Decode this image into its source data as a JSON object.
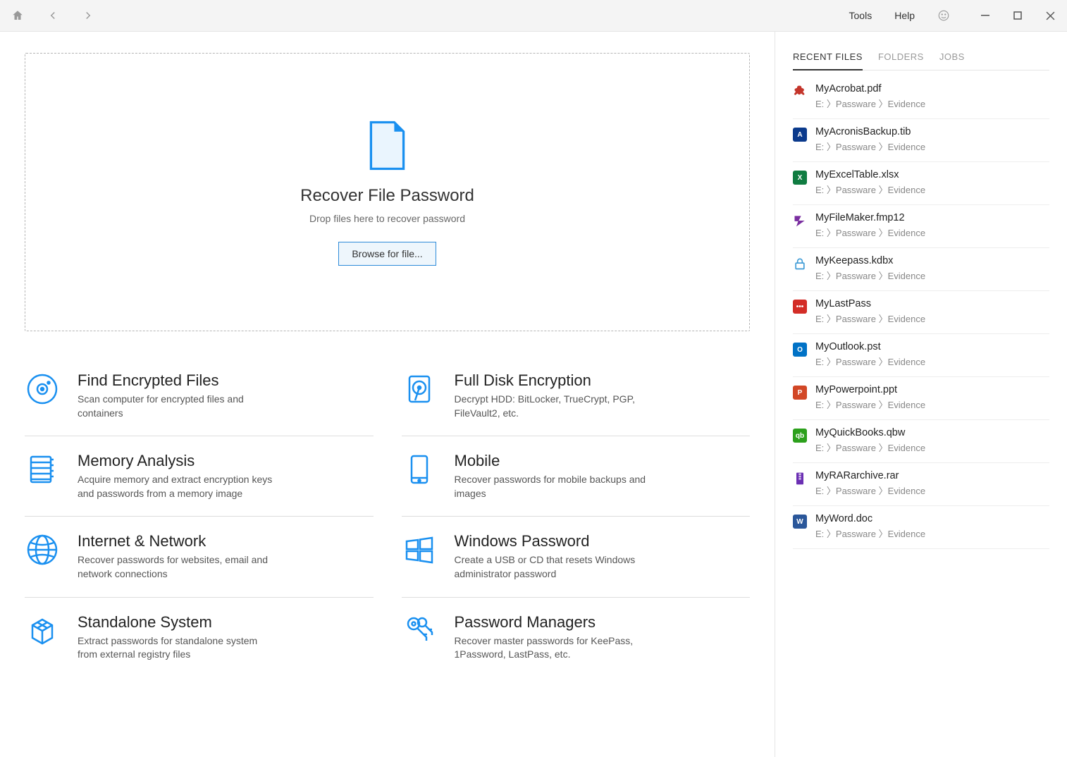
{
  "toolbar": {
    "menu": {
      "tools": "Tools",
      "help": "Help"
    }
  },
  "dropzone": {
    "title": "Recover File Password",
    "subtitle": "Drop files here to recover password",
    "browse_label": "Browse for file..."
  },
  "features": [
    {
      "title": "Find Encrypted Files",
      "desc": "Scan computer for encrypted files and containers",
      "icon": "disc"
    },
    {
      "title": "Memory Analysis",
      "desc": "Acquire memory and extract encryption keys and passwords from a memory image",
      "icon": "memory"
    },
    {
      "title": "Internet & Network",
      "desc": "Recover passwords for websites, email and network connections",
      "icon": "globe"
    },
    {
      "title": "Standalone System",
      "desc": "Extract passwords for standalone system from external registry files",
      "icon": "cube"
    },
    {
      "title": "Full Disk Encryption",
      "desc": "Decrypt HDD: BitLocker, TrueCrypt, PGP, FileVault2, etc.",
      "icon": "hdd"
    },
    {
      "title": "Mobile",
      "desc": "Recover passwords for mobile backups and images",
      "icon": "mobile"
    },
    {
      "title": "Windows Password",
      "desc": "Create a USB or CD that resets Windows administrator password",
      "icon": "windows"
    },
    {
      "title": "Password Managers",
      "desc": "Recover master passwords for KeePass, 1Password, LastPass, etc.",
      "icon": "key"
    }
  ],
  "sidebar": {
    "tabs": [
      {
        "label": "RECENT FILES",
        "active": true
      },
      {
        "label": "FOLDERS",
        "active": false
      },
      {
        "label": "JOBS",
        "active": false
      }
    ],
    "recent": [
      {
        "name": "MyAcrobat.pdf",
        "path": "E: 〉Passware 〉Evidence",
        "iconColor": "#c4352b",
        "iconText": "",
        "iconKind": "pdf"
      },
      {
        "name": "MyAcronisBackup.tib",
        "path": "E: 〉Passware 〉Evidence",
        "iconColor": "#0b3a8c",
        "iconText": "A"
      },
      {
        "name": "MyExcelTable.xlsx",
        "path": "E: 〉Passware 〉Evidence",
        "iconColor": "#107c41",
        "iconText": "X"
      },
      {
        "name": "MyFileMaker.fmp12",
        "path": "E: 〉Passware 〉Evidence",
        "iconColor": "#7a2ea0",
        "iconText": "",
        "iconKind": "fm"
      },
      {
        "name": "MyKeepass.kdbx",
        "path": "E: 〉Passware 〉Evidence",
        "iconColor": "#ffffff",
        "iconText": "",
        "iconKind": "lock"
      },
      {
        "name": "MyLastPass",
        "path": "E: 〉Passware 〉Evidence",
        "iconColor": "#d32d27",
        "iconText": "•••"
      },
      {
        "name": "MyOutlook.pst",
        "path": "E: 〉Passware 〉Evidence",
        "iconColor": "#0072c6",
        "iconText": "O"
      },
      {
        "name": "MyPowerpoint.ppt",
        "path": "E: 〉Passware 〉Evidence",
        "iconColor": "#d24726",
        "iconText": "P"
      },
      {
        "name": "MyQuickBooks.qbw",
        "path": "E: 〉Passware 〉Evidence",
        "iconColor": "#2ca01c",
        "iconText": "qb"
      },
      {
        "name": "MyRARarchive.rar",
        "path": "E: 〉Passware 〉Evidence",
        "iconColor": "#6b2fb3",
        "iconText": "",
        "iconKind": "rar"
      },
      {
        "name": "MyWord.doc",
        "path": "E: 〉Passware 〉Evidence",
        "iconColor": "#2b579a",
        "iconText": "W"
      }
    ]
  }
}
